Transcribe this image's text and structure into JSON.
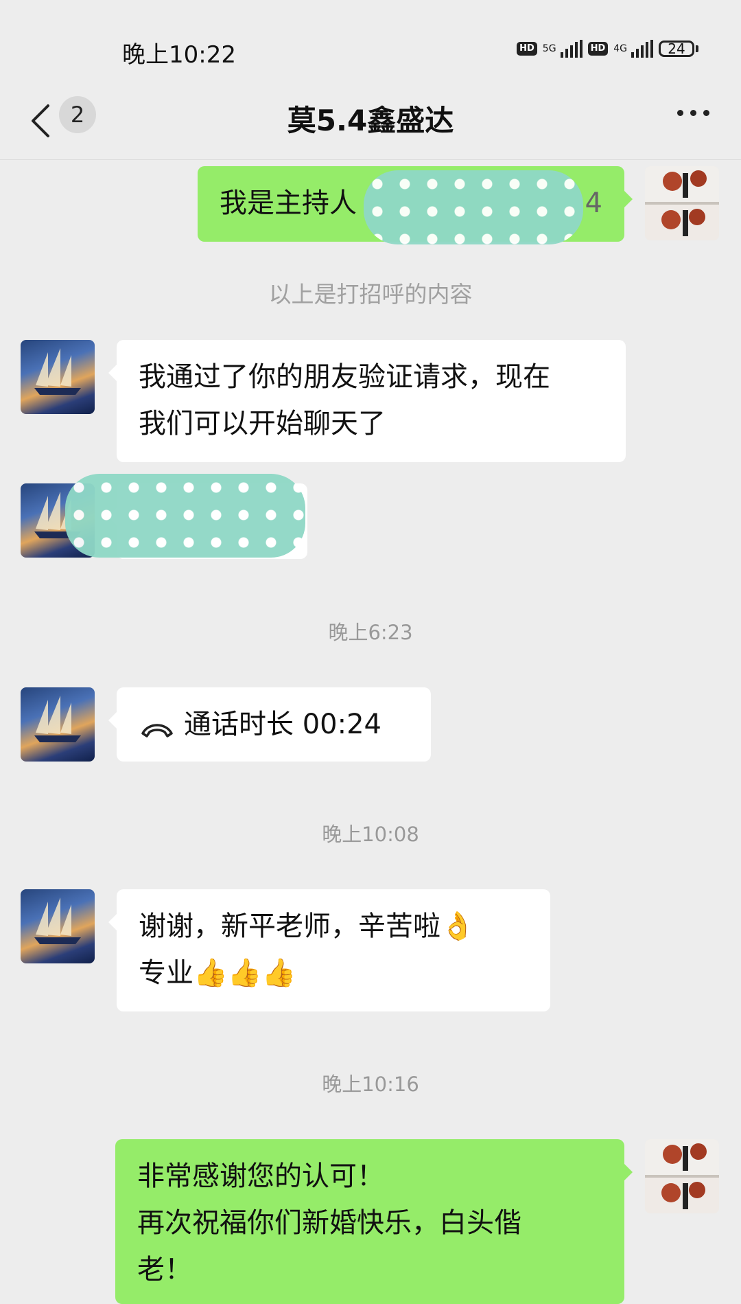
{
  "status_bar": {
    "time": "晚上10:22",
    "hd1": "HD",
    "net1": "5G",
    "hd2": "HD",
    "net2": "4G",
    "battery": "24"
  },
  "header": {
    "back_icon": "chevron-left-icon",
    "unread_count": "2",
    "title": "莫5.4鑫盛达",
    "more_icon": "more-horizontal-icon"
  },
  "messages": {
    "m1": {
      "text_visible_start": "我是主持人",
      "text_visible_end": "4"
    },
    "system_notice": "以上是打招呼的内容",
    "m2": {
      "line1": "我通过了你的朋友验证请求，现在",
      "line2": "我们可以开始聊天了"
    },
    "ts1": "晚上6:23",
    "m4": {
      "call_icon": "phone-hangup-icon",
      "text": "通话时长 00:24"
    },
    "ts2": "晚上10:08",
    "m5": {
      "line1": "谢谢，新平老师，辛苦啦👌",
      "line2": "专业👍👍👍"
    },
    "ts3": "晚上10:16",
    "m6": {
      "line1": "非常感谢您的认可！",
      "line2": "再次祝福你们新婚快乐，白头偕",
      "line3": "老！"
    }
  },
  "colors": {
    "background": "#ededed",
    "outgoing_bubble": "#95ec69",
    "incoming_bubble": "#ffffff"
  }
}
